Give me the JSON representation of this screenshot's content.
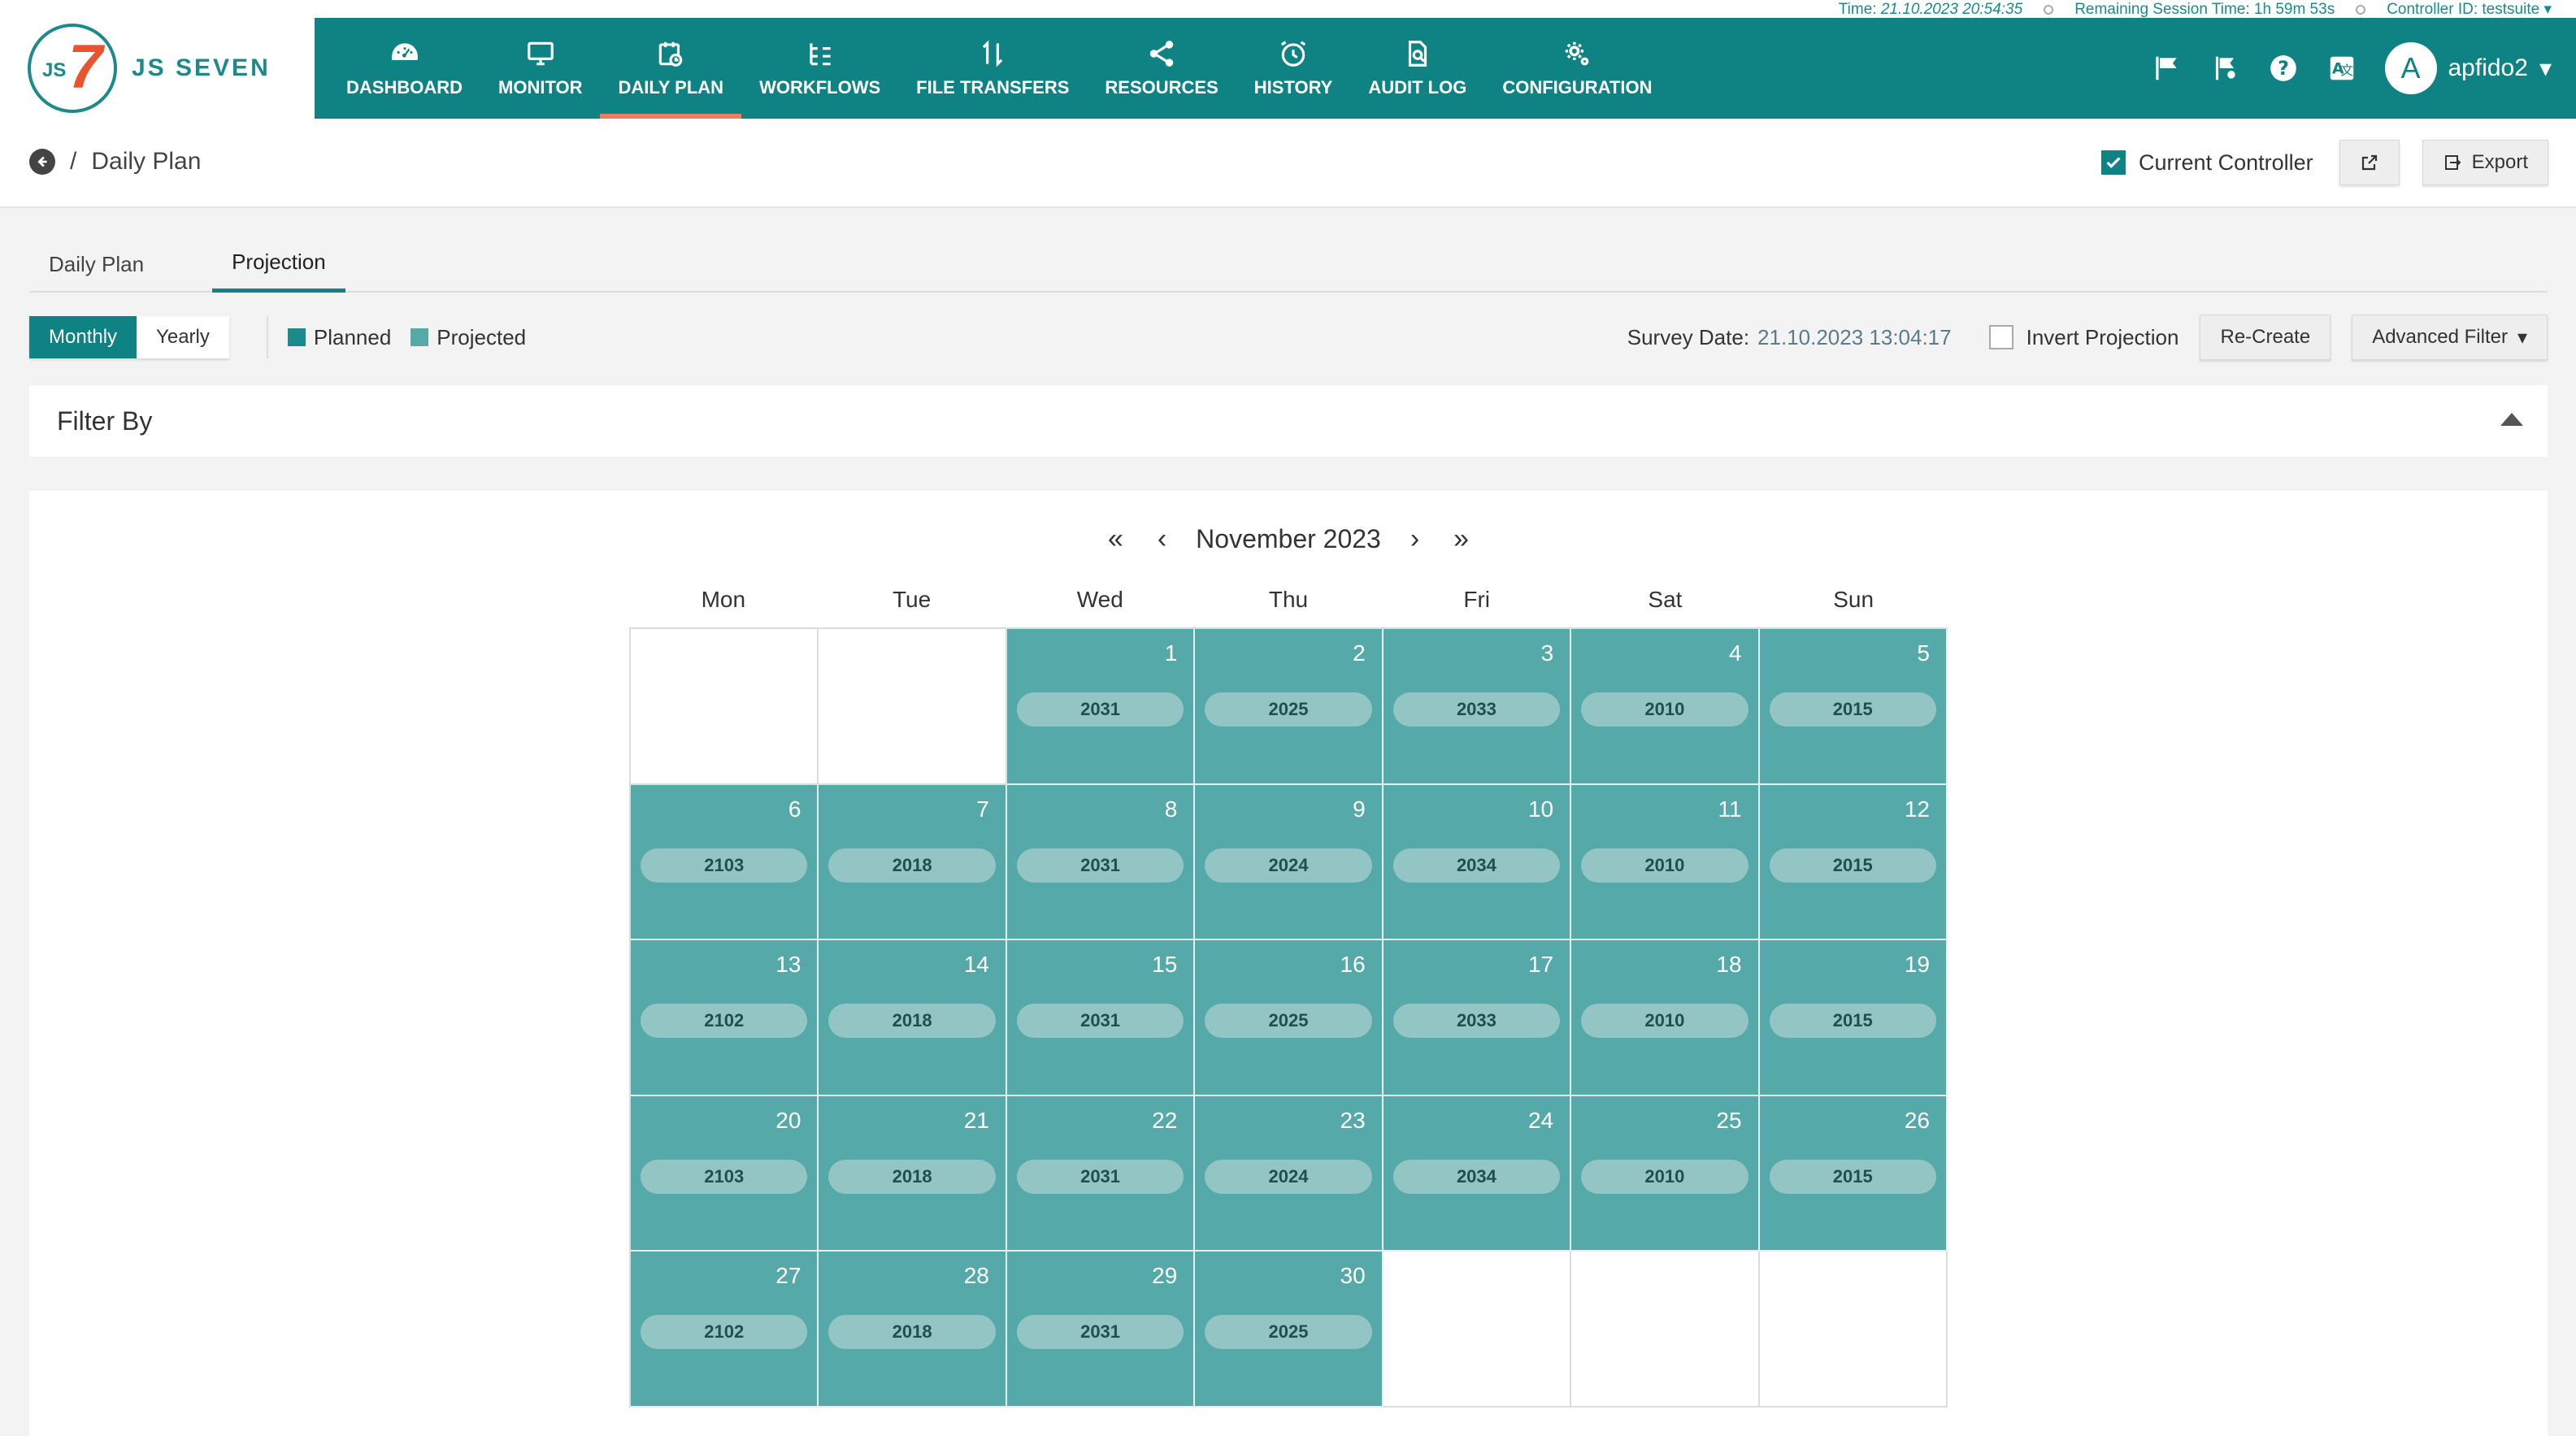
{
  "status": {
    "time_label": "Time:",
    "time_value": "21.10.2023 20:54:35",
    "session_label": "Remaining Session Time:",
    "session_value": "1h 59m 53s",
    "controller_label": "Controller ID:",
    "controller_value": "testsuite"
  },
  "brand": {
    "logo_letters": "JS",
    "logo_seven": "7",
    "name": "JS SEVEN"
  },
  "nav": {
    "items": [
      {
        "label": "DASHBOARD",
        "icon": "dashboard-icon"
      },
      {
        "label": "MONITOR",
        "icon": "monitor-icon"
      },
      {
        "label": "DAILY PLAN",
        "icon": "calendar-clock-icon"
      },
      {
        "label": "WORKFLOWS",
        "icon": "workflow-icon"
      },
      {
        "label": "FILE TRANSFERS",
        "icon": "transfer-icon"
      },
      {
        "label": "RESOURCES",
        "icon": "share-icon"
      },
      {
        "label": "HISTORY",
        "icon": "alarm-clock-icon"
      },
      {
        "label": "AUDIT LOG",
        "icon": "document-search-icon"
      },
      {
        "label": "CONFIGURATION",
        "icon": "gears-icon"
      }
    ],
    "active_index": 2
  },
  "user": {
    "avatar_letter": "A",
    "name": "apfido2"
  },
  "breadcrumb": {
    "separator": "/",
    "page": "Daily Plan"
  },
  "actions": {
    "current_controller_label": "Current Controller",
    "current_controller_checked": true,
    "export_label": "Export"
  },
  "tabs": [
    {
      "label": "Daily Plan",
      "active": false
    },
    {
      "label": "Projection",
      "active": true
    }
  ],
  "toolbar": {
    "monthly_label": "Monthly",
    "yearly_label": "Yearly",
    "legend_planned": "Planned",
    "legend_projected": "Projected",
    "survey_label": "Survey Date:",
    "survey_value": "21.10.2023 13:04:17",
    "invert_label": "Invert Projection",
    "recreate_label": "Re-Create",
    "advanced_filter_label": "Advanced Filter"
  },
  "filter": {
    "title": "Filter By"
  },
  "calendar": {
    "month_label": "November 2023",
    "weekdays": [
      "Mon",
      "Tue",
      "Wed",
      "Thu",
      "Fri",
      "Sat",
      "Sun"
    ],
    "cells": [
      {
        "day": "",
        "count": ""
      },
      {
        "day": "",
        "count": ""
      },
      {
        "day": "1",
        "count": "2031"
      },
      {
        "day": "2",
        "count": "2025"
      },
      {
        "day": "3",
        "count": "2033"
      },
      {
        "day": "4",
        "count": "2010"
      },
      {
        "day": "5",
        "count": "2015"
      },
      {
        "day": "6",
        "count": "2103"
      },
      {
        "day": "7",
        "count": "2018"
      },
      {
        "day": "8",
        "count": "2031"
      },
      {
        "day": "9",
        "count": "2024"
      },
      {
        "day": "10",
        "count": "2034"
      },
      {
        "day": "11",
        "count": "2010"
      },
      {
        "day": "12",
        "count": "2015"
      },
      {
        "day": "13",
        "count": "2102"
      },
      {
        "day": "14",
        "count": "2018"
      },
      {
        "day": "15",
        "count": "2031"
      },
      {
        "day": "16",
        "count": "2025"
      },
      {
        "day": "17",
        "count": "2033"
      },
      {
        "day": "18",
        "count": "2010"
      },
      {
        "day": "19",
        "count": "2015"
      },
      {
        "day": "20",
        "count": "2103"
      },
      {
        "day": "21",
        "count": "2018"
      },
      {
        "day": "22",
        "count": "2031"
      },
      {
        "day": "23",
        "count": "2024"
      },
      {
        "day": "24",
        "count": "2034"
      },
      {
        "day": "25",
        "count": "2010"
      },
      {
        "day": "26",
        "count": "2015"
      },
      {
        "day": "27",
        "count": "2102"
      },
      {
        "day": "28",
        "count": "2018"
      },
      {
        "day": "29",
        "count": "2031"
      },
      {
        "day": "30",
        "count": "2025"
      },
      {
        "day": "",
        "count": ""
      },
      {
        "day": "",
        "count": ""
      },
      {
        "day": "",
        "count": ""
      }
    ]
  },
  "colors": {
    "brand": "#0f8383",
    "accent": "#f07b5e",
    "planned": "#1a8a8a",
    "projected": "#56a9a9",
    "pill": "#93c5c5"
  }
}
